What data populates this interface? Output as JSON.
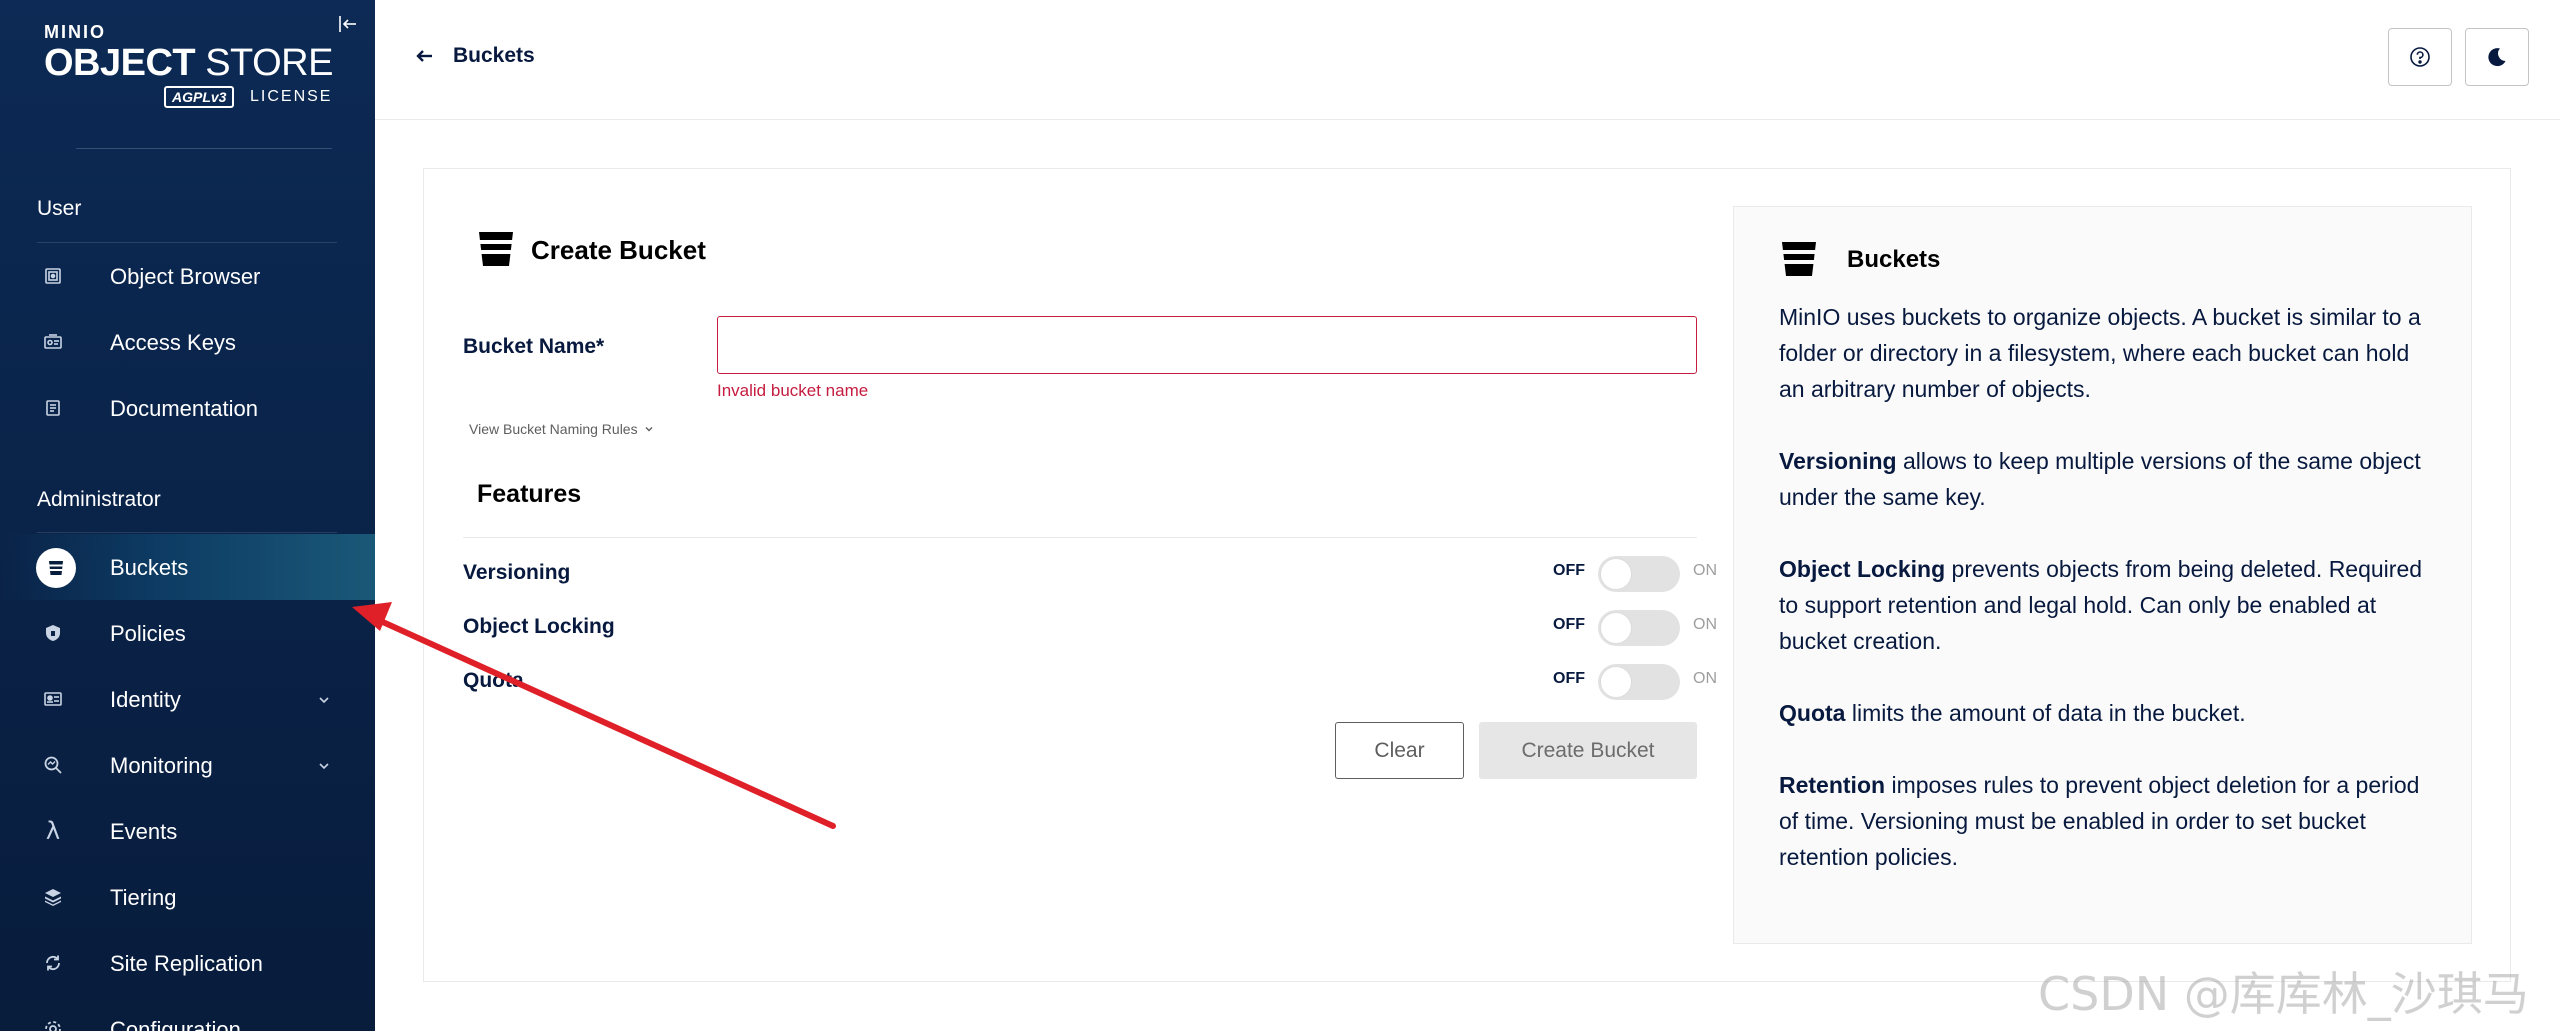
{
  "sidebar": {
    "logo": {
      "brand": "MINIO",
      "title_bold": "OBJECT",
      "title_thin": "STORE",
      "agpl": "AGPLv3",
      "license": "LICENSE"
    },
    "sections": [
      {
        "title": "User"
      },
      {
        "title": "Administrator"
      }
    ],
    "user_items": [
      {
        "label": "Object Browser",
        "icon": "object-browser-icon"
      },
      {
        "label": "Access Keys",
        "icon": "access-keys-icon"
      },
      {
        "label": "Documentation",
        "icon": "documentation-icon"
      }
    ],
    "admin_items": [
      {
        "label": "Buckets",
        "icon": "buckets-icon",
        "active": true
      },
      {
        "label": "Policies",
        "icon": "policies-icon"
      },
      {
        "label": "Identity",
        "icon": "identity-icon",
        "expandable": true
      },
      {
        "label": "Monitoring",
        "icon": "monitoring-icon",
        "expandable": true
      },
      {
        "label": "Events",
        "icon": "events-icon"
      },
      {
        "label": "Tiering",
        "icon": "tiering-icon"
      },
      {
        "label": "Site Replication",
        "icon": "site-replication-icon"
      },
      {
        "label": "Configuration",
        "icon": "configuration-icon"
      }
    ]
  },
  "header": {
    "back_label": "Buckets"
  },
  "form": {
    "title": "Create Bucket",
    "bucket_name_label": "Bucket Name*",
    "bucket_name_value": "",
    "bucket_name_error": "Invalid bucket name",
    "naming_rules_link": "View Bucket Naming Rules",
    "features_title": "Features",
    "features": [
      {
        "label": "Versioning",
        "off_label": "OFF",
        "on_label": "ON",
        "enabled": false
      },
      {
        "label": "Object Locking",
        "off_label": "OFF",
        "on_label": "ON",
        "enabled": false
      },
      {
        "label": "Quota",
        "off_label": "OFF",
        "on_label": "ON",
        "enabled": false
      }
    ],
    "clear_button": "Clear",
    "create_button": "Create Bucket"
  },
  "help": {
    "title": "Buckets",
    "intro": "MinIO uses buckets to organize objects. A bucket is similar to a folder or directory in a filesystem, where each bucket can hold an arbitrary number of objects.",
    "versioning_term": "Versioning",
    "versioning_text": " allows to keep multiple versions of the same object under the same key.",
    "locking_term": "Object Locking",
    "locking_text": " prevents objects from being deleted. Required to support retention and legal hold. Can only be enabled at bucket creation.",
    "quota_term": "Quota",
    "quota_text": " limits the amount of data in the bucket.",
    "retention_term": "Retention",
    "retention_text": " imposes rules to prevent object deletion for a period of time. Versioning must be enabled in order to set bucket retention policies."
  },
  "watermark": "CSDN @库库林_沙琪马",
  "colors": {
    "sidebar_bg": "#0c2a55",
    "error": "#c51c3f",
    "annotation_arrow": "#e02028"
  }
}
